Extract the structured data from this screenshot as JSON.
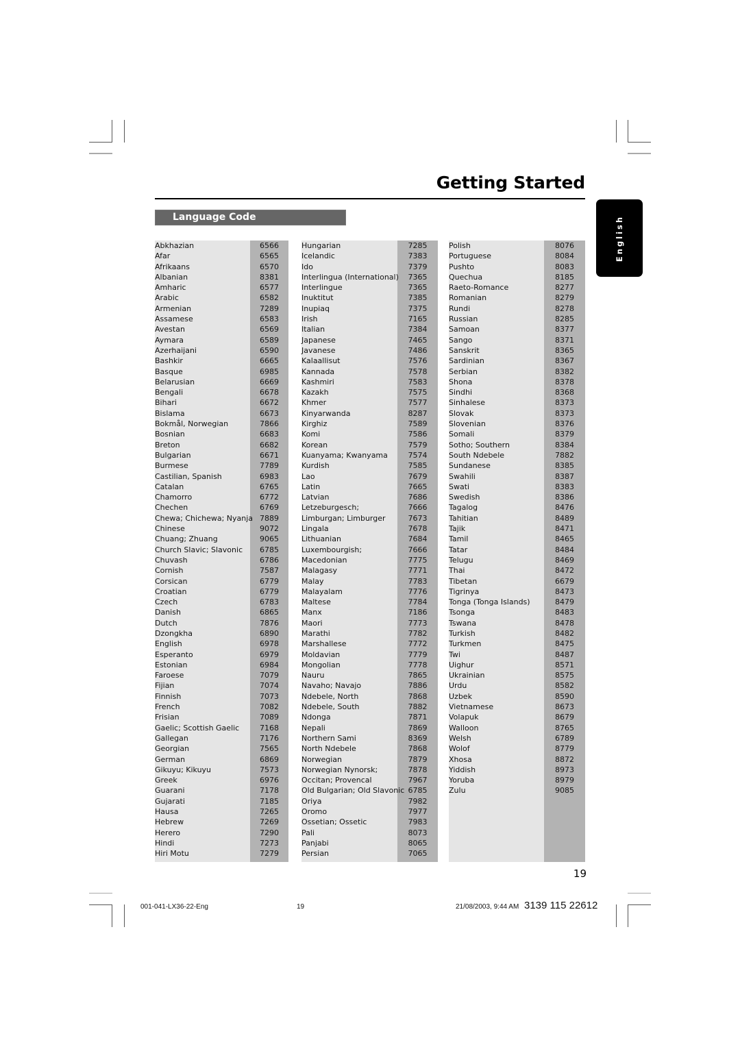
{
  "header": {
    "title": "Getting Started"
  },
  "section": {
    "title": "Language Code"
  },
  "side_tab": {
    "label": "English"
  },
  "columns": [
    {
      "rows": [
        {
          "name": "Abkhazian",
          "code": "6566"
        },
        {
          "name": "Afar",
          "code": "6565"
        },
        {
          "name": "Afrikaans",
          "code": "6570"
        },
        {
          "name": "Albanian",
          "code": "8381"
        },
        {
          "name": "Amharic",
          "code": "6577"
        },
        {
          "name": "Arabic",
          "code": "6582"
        },
        {
          "name": "Armenian",
          "code": "7289"
        },
        {
          "name": "Assamese",
          "code": "6583"
        },
        {
          "name": "Avestan",
          "code": "6569"
        },
        {
          "name": "Aymara",
          "code": "6589"
        },
        {
          "name": "Azerhaijani",
          "code": "6590"
        },
        {
          "name": "Bashkir",
          "code": "6665"
        },
        {
          "name": "Basque",
          "code": "6985"
        },
        {
          "name": "Belarusian",
          "code": "6669"
        },
        {
          "name": "Bengali",
          "code": "6678"
        },
        {
          "name": "Bihari",
          "code": "6672"
        },
        {
          "name": "Bislama",
          "code": "6673"
        },
        {
          "name": "Bokmål, Norwegian",
          "code": "7866"
        },
        {
          "name": "Bosnian",
          "code": "6683"
        },
        {
          "name": "Breton",
          "code": "6682"
        },
        {
          "name": "Bulgarian",
          "code": "6671"
        },
        {
          "name": "Burmese",
          "code": "7789"
        },
        {
          "name": "Castilian, Spanish",
          "code": "6983"
        },
        {
          "name": "Catalan",
          "code": "6765"
        },
        {
          "name": "Chamorro",
          "code": "6772"
        },
        {
          "name": "Chechen",
          "code": "6769"
        },
        {
          "name": "Chewa; Chichewa; Nyanja",
          "code": "7889"
        },
        {
          "name": "Chinese",
          "code": "9072"
        },
        {
          "name": "Chuang; Zhuang",
          "code": "9065"
        },
        {
          "name": "Church Slavic; Slavonic",
          "code": "6785"
        },
        {
          "name": "Chuvash",
          "code": "6786"
        },
        {
          "name": "Cornish",
          "code": "7587"
        },
        {
          "name": "Corsican",
          "code": "6779"
        },
        {
          "name": "Croatian",
          "code": "6779"
        },
        {
          "name": "Czech",
          "code": "6783"
        },
        {
          "name": "Danish",
          "code": "6865"
        },
        {
          "name": "Dutch",
          "code": "7876"
        },
        {
          "name": "Dzongkha",
          "code": "6890"
        },
        {
          "name": "English",
          "code": "6978"
        },
        {
          "name": "Esperanto",
          "code": "6979"
        },
        {
          "name": "Estonian",
          "code": "6984"
        },
        {
          "name": "Faroese",
          "code": "7079"
        },
        {
          "name": "Fijian",
          "code": "7074"
        },
        {
          "name": "Finnish",
          "code": "7073"
        },
        {
          "name": "French",
          "code": "7082"
        },
        {
          "name": "Frisian",
          "code": "7089"
        },
        {
          "name": "Gaelic; Scottish Gaelic",
          "code": "7168"
        },
        {
          "name": "Gallegan",
          "code": "7176"
        },
        {
          "name": "Georgian",
          "code": "7565"
        },
        {
          "name": "German",
          "code": "6869"
        },
        {
          "name": "Gikuyu; Kikuyu",
          "code": "7573"
        },
        {
          "name": "Greek",
          "code": "6976"
        },
        {
          "name": "Guarani",
          "code": "7178"
        },
        {
          "name": "Gujarati",
          "code": "7185"
        },
        {
          "name": "Hausa",
          "code": "7265"
        },
        {
          "name": "Hebrew",
          "code": "7269"
        },
        {
          "name": "Herero",
          "code": "7290"
        },
        {
          "name": "Hindi",
          "code": "7273"
        },
        {
          "name": "Hiri Motu",
          "code": "7279"
        }
      ]
    },
    {
      "rows": [
        {
          "name": "Hungarian",
          "code": "7285"
        },
        {
          "name": "Icelandic",
          "code": "7383"
        },
        {
          "name": "Ido",
          "code": "7379"
        },
        {
          "name": "Interlingua (International)",
          "code": "7365"
        },
        {
          "name": "Interlingue",
          "code": "7365"
        },
        {
          "name": "Inuktitut",
          "code": "7385"
        },
        {
          "name": "Inupiaq",
          "code": "7375"
        },
        {
          "name": "Irish",
          "code": "7165"
        },
        {
          "name": "Italian",
          "code": "7384"
        },
        {
          "name": "Japanese",
          "code": "7465"
        },
        {
          "name": "Javanese",
          "code": "7486"
        },
        {
          "name": "Kalaallisut",
          "code": "7576"
        },
        {
          "name": "Kannada",
          "code": "7578"
        },
        {
          "name": "Kashmiri",
          "code": "7583"
        },
        {
          "name": "Kazakh",
          "code": "7575"
        },
        {
          "name": "Khmer",
          "code": "7577"
        },
        {
          "name": "Kinyarwanda",
          "code": "8287"
        },
        {
          "name": "Kirghiz",
          "code": "7589"
        },
        {
          "name": "Komi",
          "code": "7586"
        },
        {
          "name": "Korean",
          "code": "7579"
        },
        {
          "name": "Kuanyama; Kwanyama",
          "code": "7574"
        },
        {
          "name": "Kurdish",
          "code": "7585"
        },
        {
          "name": "Lao",
          "code": "7679"
        },
        {
          "name": "Latin",
          "code": "7665"
        },
        {
          "name": "Latvian",
          "code": "7686"
        },
        {
          "name": "Letzeburgesch;",
          "code": "7666"
        },
        {
          "name": "Limburgan; Limburger",
          "code": "7673"
        },
        {
          "name": "Lingala",
          "code": "7678"
        },
        {
          "name": "Lithuanian",
          "code": "7684"
        },
        {
          "name": "Luxembourgish;",
          "code": "7666"
        },
        {
          "name": "Macedonian",
          "code": "7775"
        },
        {
          "name": "Malagasy",
          "code": "7771"
        },
        {
          "name": "Malay",
          "code": "7783"
        },
        {
          "name": "Malayalam",
          "code": "7776"
        },
        {
          "name": "Maltese",
          "code": "7784"
        },
        {
          "name": "Manx",
          "code": "7186"
        },
        {
          "name": "Maori",
          "code": "7773"
        },
        {
          "name": "Marathi",
          "code": "7782"
        },
        {
          "name": "Marshallese",
          "code": "7772"
        },
        {
          "name": "Moldavian",
          "code": "7779"
        },
        {
          "name": "Mongolian",
          "code": "7778"
        },
        {
          "name": "Nauru",
          "code": "7865"
        },
        {
          "name": "Navaho; Navajo",
          "code": "7886"
        },
        {
          "name": "Ndebele, North",
          "code": "7868"
        },
        {
          "name": "Ndebele, South",
          "code": "7882"
        },
        {
          "name": "Ndonga",
          "code": "7871"
        },
        {
          "name": "Nepali",
          "code": "7869"
        },
        {
          "name": "Northern Sami",
          "code": "8369"
        },
        {
          "name": "North Ndebele",
          "code": "7868"
        },
        {
          "name": "Norwegian",
          "code": "7879"
        },
        {
          "name": "Norwegian Nynorsk;",
          "code": "7878"
        },
        {
          "name": "Occitan; Provencal",
          "code": "7967"
        },
        {
          "name": "Old Bulgarian; Old Slavonic",
          "code": "6785"
        },
        {
          "name": "Oriya",
          "code": "7982"
        },
        {
          "name": "Oromo",
          "code": "7977"
        },
        {
          "name": "Ossetian; Ossetic",
          "code": "7983"
        },
        {
          "name": "Pali",
          "code": "8073"
        },
        {
          "name": "Panjabi",
          "code": "8065"
        },
        {
          "name": "Persian",
          "code": "7065"
        }
      ]
    },
    {
      "rows": [
        {
          "name": "Polish",
          "code": "8076"
        },
        {
          "name": "Portuguese",
          "code": "8084"
        },
        {
          "name": "Pushto",
          "code": "8083"
        },
        {
          "name": "Quechua",
          "code": "8185"
        },
        {
          "name": "Raeto-Romance",
          "code": "8277"
        },
        {
          "name": "Romanian",
          "code": "8279"
        },
        {
          "name": "Rundi",
          "code": "8278"
        },
        {
          "name": "Russian",
          "code": "8285"
        },
        {
          "name": "Samoan",
          "code": "8377"
        },
        {
          "name": "Sango",
          "code": "8371"
        },
        {
          "name": "Sanskrit",
          "code": "8365"
        },
        {
          "name": "Sardinian",
          "code": "8367"
        },
        {
          "name": "Serbian",
          "code": "8382"
        },
        {
          "name": "Shona",
          "code": "8378"
        },
        {
          "name": "Sindhi",
          "code": "8368"
        },
        {
          "name": "Sinhalese",
          "code": "8373"
        },
        {
          "name": "Slovak",
          "code": "8373"
        },
        {
          "name": "Slovenian",
          "code": "8376"
        },
        {
          "name": "Somali",
          "code": "8379"
        },
        {
          "name": "Sotho; Southern",
          "code": "8384"
        },
        {
          "name": "South Ndebele",
          "code": "7882"
        },
        {
          "name": "Sundanese",
          "code": "8385"
        },
        {
          "name": "Swahili",
          "code": "8387"
        },
        {
          "name": "Swati",
          "code": "8383"
        },
        {
          "name": "Swedish",
          "code": "8386"
        },
        {
          "name": "Tagalog",
          "code": "8476"
        },
        {
          "name": "Tahitian",
          "code": "8489"
        },
        {
          "name": "Tajik",
          "code": "8471"
        },
        {
          "name": "Tamil",
          "code": "8465"
        },
        {
          "name": "Tatar",
          "code": "8484"
        },
        {
          "name": "Telugu",
          "code": "8469"
        },
        {
          "name": "Thai",
          "code": "8472"
        },
        {
          "name": "Tibetan",
          "code": "6679"
        },
        {
          "name": "Tigrinya",
          "code": "8473"
        },
        {
          "name": "Tonga (Tonga Islands)",
          "code": "8479"
        },
        {
          "name": "Tsonga",
          "code": "8483"
        },
        {
          "name": "Tswana",
          "code": "8478"
        },
        {
          "name": "Turkish",
          "code": "8482"
        },
        {
          "name": "Turkmen",
          "code": "8475"
        },
        {
          "name": "Twi",
          "code": "8487"
        },
        {
          "name": "Uighur",
          "code": "8571"
        },
        {
          "name": "Ukrainian",
          "code": "8575"
        },
        {
          "name": "Urdu",
          "code": "8582"
        },
        {
          "name": "Uzbek",
          "code": "8590"
        },
        {
          "name": "Vietnamese",
          "code": "8673"
        },
        {
          "name": "Volapuk",
          "code": "8679"
        },
        {
          "name": "Walloon",
          "code": "8765"
        },
        {
          "name": "Welsh",
          "code": "6789"
        },
        {
          "name": "Wolof",
          "code": "8779"
        },
        {
          "name": "Xhosa",
          "code": "8872"
        },
        {
          "name": "Yiddish",
          "code": "8973"
        },
        {
          "name": "Yoruba",
          "code": "8979"
        },
        {
          "name": "Zulu",
          "code": "9085"
        }
      ]
    }
  ],
  "page_number": "19",
  "footer": {
    "file_name": "001-041-LX36-22-Eng",
    "page": "19",
    "timestamp": "21/08/2003, 9:44 AM",
    "doc_code": "3139 115 22612"
  }
}
